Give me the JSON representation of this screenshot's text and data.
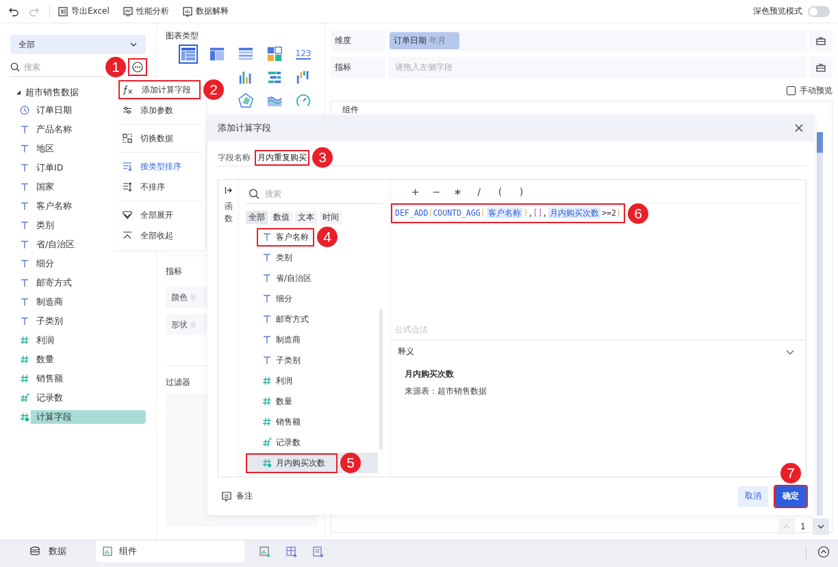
{
  "toolbar": {
    "buttons": [
      {
        "label": "导出Excel",
        "kind": "excel"
      },
      {
        "label": "性能分析",
        "kind": "performance"
      },
      {
        "label": "数据解释",
        "kind": "explain"
      }
    ],
    "dark_mode": {
      "label": "深色预览模式",
      "on": false
    }
  },
  "data_panel": {
    "dataset": "全部",
    "search": {
      "placeholder": "搜索"
    },
    "more_button": {
      "callout": {
        "number": "1"
      }
    },
    "tree": {
      "label": "超市销售数据",
      "expanded": true,
      "children": [
        {
          "label": "订单日期",
          "kind": "date",
          "selected": false
        },
        {
          "label": "产品名称",
          "kind": "text",
          "selected": false
        },
        {
          "label": "地区",
          "kind": "text",
          "selected": false
        },
        {
          "label": "订单ID",
          "kind": "text",
          "selected": false
        },
        {
          "label": "国家",
          "kind": "text",
          "selected": false
        },
        {
          "label": "客户名称",
          "kind": "text",
          "selected": false
        },
        {
          "label": "类别",
          "kind": "text",
          "selected": false
        },
        {
          "label": "省/自治区",
          "kind": "text",
          "selected": false
        },
        {
          "label": "细分",
          "kind": "text",
          "selected": false
        },
        {
          "label": "邮寄方式",
          "kind": "text",
          "selected": false
        },
        {
          "label": "制造商",
          "kind": "text",
          "selected": false
        },
        {
          "label": "子类别",
          "kind": "text",
          "selected": false
        },
        {
          "label": "利润",
          "kind": "number",
          "selected": false
        },
        {
          "label": "数量",
          "kind": "number",
          "selected": false
        },
        {
          "label": "销售额",
          "kind": "number",
          "selected": false
        },
        {
          "label": "记录数",
          "kind": "count",
          "selected": false
        },
        {
          "label": "计算字段",
          "kind": "calc",
          "selected": true
        }
      ]
    }
  },
  "field_menu": {
    "groups": [
      [
        {
          "label": "添加计算字段",
          "kind": "fx",
          "active": false,
          "callout": {
            "number": "2"
          }
        },
        {
          "label": "添加参数",
          "kind": "param",
          "active": false
        }
      ],
      [
        {
          "label": "切换数据",
          "kind": "switch",
          "active": false
        }
      ],
      [
        {
          "label": "按类型排序",
          "kind": "sort-type",
          "active": true
        },
        {
          "label": "不排序",
          "kind": "no-sort",
          "active": false
        }
      ],
      [
        {
          "label": "全部展开",
          "kind": "expand",
          "active": false
        },
        {
          "label": "全部收起",
          "kind": "collapse",
          "active": false
        }
      ]
    ]
  },
  "chart_panel": {
    "title": "图表类型",
    "chart_types": [
      [
        {
          "kind": "table",
          "selected": true
        },
        {
          "kind": "crosstab",
          "selected": false
        },
        {
          "kind": "detail",
          "selected": false
        },
        {
          "kind": "blocks",
          "selected": false
        },
        {
          "kind": "kpi",
          "label": "123",
          "selected": false
        }
      ],
      [
        {
          "kind": "bar",
          "selected": false
        },
        {
          "kind": "bullet",
          "selected": false
        },
        {
          "kind": "waterfall",
          "selected": false
        }
      ],
      [
        {
          "kind": "radar",
          "selected": false
        },
        {
          "kind": "area",
          "selected": false
        },
        {
          "kind": "gauge",
          "selected": false
        }
      ]
    ],
    "measure_section": {
      "title": "指标",
      "chips": [
        "颜色",
        "形状"
      ]
    },
    "filter_section": {
      "title": "过滤器"
    }
  },
  "builder": {
    "rows": [
      {
        "label": "维度",
        "chip": {
          "name": "订单日期",
          "detail": "年月"
        }
      },
      {
        "label": "指标",
        "placeholder": "请拖入左侧字段"
      }
    ],
    "manual_preview": {
      "label": "手动预览",
      "checked": false
    },
    "component": {
      "title": "组件",
      "page": "1"
    }
  },
  "dialog": {
    "title": "添加计算字段",
    "field_name": {
      "label": "字段名称",
      "value": "月内重复购买",
      "callout": {
        "number": "3"
      }
    },
    "function_tab": "函数",
    "field_search": {
      "placeholder": "搜索"
    },
    "filters": [
      {
        "label": "全部",
        "selected": true
      },
      {
        "label": "数值",
        "selected": false
      },
      {
        "label": "文本",
        "selected": false
      },
      {
        "label": "时间",
        "selected": false
      }
    ],
    "fields": [
      {
        "label": "客户名称",
        "kind": "text",
        "selected": false,
        "callout": {
          "number": "4"
        }
      },
      {
        "label": "类别",
        "kind": "text",
        "selected": false
      },
      {
        "label": "省/自治区",
        "kind": "text",
        "selected": false
      },
      {
        "label": "细分",
        "kind": "text",
        "selected": false
      },
      {
        "label": "邮寄方式",
        "kind": "text",
        "selected": false
      },
      {
        "label": "制造商",
        "kind": "text",
        "selected": false
      },
      {
        "label": "子类别",
        "kind": "text",
        "selected": false
      },
      {
        "label": "利润",
        "kind": "number",
        "selected": false
      },
      {
        "label": "数量",
        "kind": "number",
        "selected": false
      },
      {
        "label": "销售额",
        "kind": "number",
        "selected": false
      },
      {
        "label": "记录数",
        "kind": "count",
        "selected": false
      },
      {
        "label": "月内购买次数",
        "kind": "calc",
        "selected": true,
        "callout": {
          "number": "5"
        }
      }
    ],
    "operators": [
      "+",
      "−",
      "∗",
      "/",
      "(",
      ")"
    ],
    "formula": {
      "tokens": [
        {
          "text": "DEF_ADD",
          "kind": "func"
        },
        {
          "text": "(",
          "kind": "paren"
        },
        {
          "text": "COUNTD_AGG",
          "kind": "func"
        },
        {
          "text": "(",
          "kind": "paren"
        },
        {
          "text": "客户名称",
          "kind": "field"
        },
        {
          "text": ")",
          "kind": "paren"
        },
        {
          "text": ",",
          "kind": "plain"
        },
        {
          "text": "[]",
          "kind": "bracket"
        },
        {
          "text": ",",
          "kind": "plain"
        },
        {
          "text": "月内购买次数",
          "kind": "field"
        },
        {
          "text": ">=2",
          "kind": "plain"
        },
        {
          "text": ")",
          "kind": "paren"
        }
      ],
      "callout": {
        "number": "6"
      }
    },
    "status": "公式合法",
    "explanation": {
      "title": "释义",
      "expanded": true,
      "name": "月内购买次数",
      "source": "来源表：超市销售数据"
    },
    "note": "备注",
    "buttons": [
      {
        "label": "取消",
        "kind": "secondary"
      },
      {
        "label": "确定",
        "kind": "primary",
        "callout": {
          "number": "7"
        }
      }
    ]
  },
  "bottom_bar": {
    "tabs": [
      {
        "label": "数据",
        "kind": "data",
        "selected": false
      },
      {
        "label": "组件",
        "kind": "component",
        "selected": true
      }
    ]
  }
}
